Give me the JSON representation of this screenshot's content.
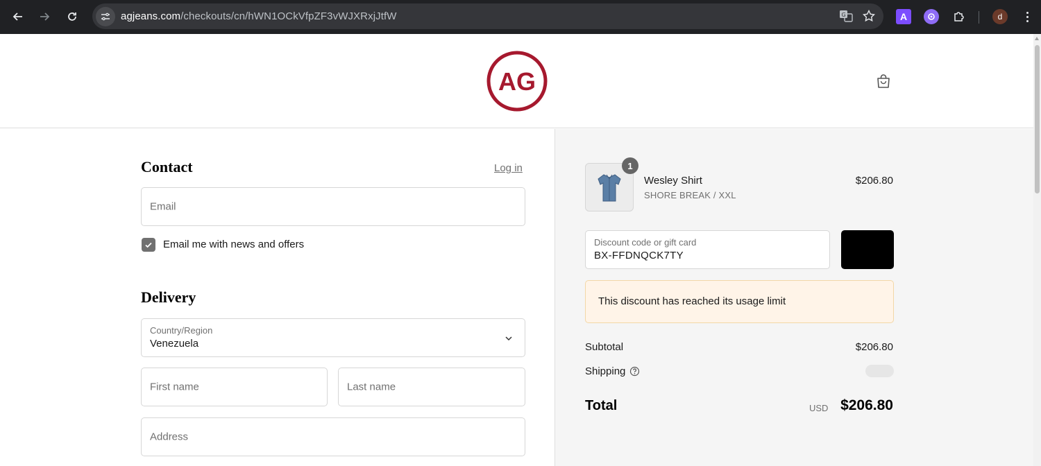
{
  "browser": {
    "url_host": "agjeans.com",
    "url_path": "/checkouts/cn/hWN1OCkVfpZF3vWJXRxjJtfW",
    "avatar_letter": "d",
    "extension_a_letter": "A"
  },
  "header": {
    "logo_text": "AG",
    "brand_color": "#a6192e"
  },
  "contact": {
    "title": "Contact",
    "login_label": "Log in",
    "email_placeholder": "Email",
    "newsletter_label": "Email me with news and offers",
    "newsletter_checked": true
  },
  "delivery": {
    "title": "Delivery",
    "country_label": "Country/Region",
    "country_value": "Venezuela",
    "first_name_placeholder": "First name",
    "last_name_placeholder": "Last name",
    "address_placeholder": "Address"
  },
  "summary": {
    "product": {
      "quantity": "1",
      "name": "Wesley Shirt",
      "variant": "SHORE BREAK / XXL",
      "price": "$206.80"
    },
    "discount": {
      "label": "Discount code or gift card",
      "value": "BX-FFDNQCK7TY",
      "error": "This discount has reached its usage limit"
    },
    "subtotal_label": "Subtotal",
    "subtotal_value": "$206.80",
    "shipping_label": "Shipping",
    "total_label": "Total",
    "total_currency": "USD",
    "total_value": "$206.80"
  }
}
